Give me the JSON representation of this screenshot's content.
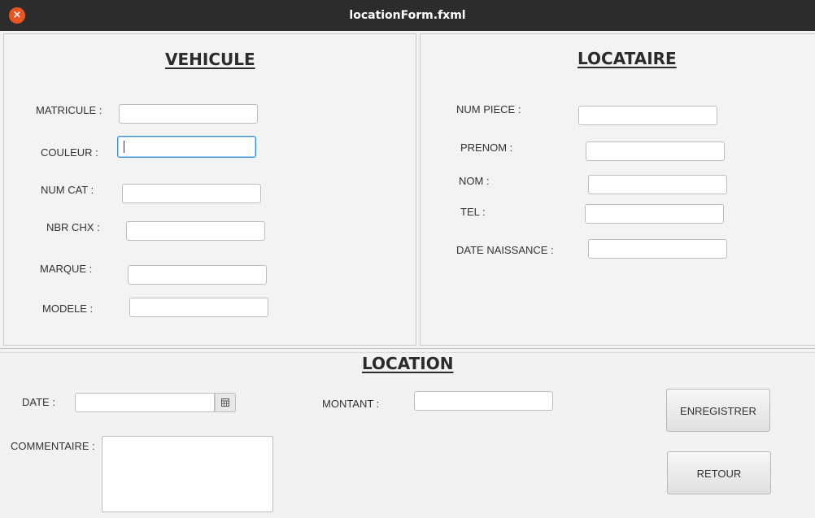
{
  "window": {
    "title": "locationForm.fxml",
    "close_symbol": "×"
  },
  "vehicule": {
    "heading": "VEHICULE",
    "matricule_label": "MATRICULE :",
    "couleur_label": "COULEUR :",
    "numcat_label": "NUM CAT :",
    "nbrchx_label": "NBR CHX :",
    "marque_label": "MARQUE :",
    "modele_label": "MODELE :",
    "matricule_value": "",
    "couleur_value": "",
    "numcat_value": "",
    "nbrchx_value": "",
    "marque_value": "",
    "modele_value": ""
  },
  "locataire": {
    "heading": "LOCATAIRE",
    "numpiece_label": "NUM PIECE :",
    "prenom_label": "PRENOM :",
    "nom_label": "NOM :",
    "tel_label": "TEL :",
    "datenaissance_label": "DATE NAISSANCE :",
    "numpiece_value": "",
    "prenom_value": "",
    "nom_value": "",
    "tel_value": "",
    "datenaissance_value": ""
  },
  "location": {
    "heading": "LOCATION",
    "date_label": "DATE :",
    "montant_label": "MONTANT :",
    "commentaire_label": "COMMENTAIRE :",
    "date_value": "",
    "montant_value": "",
    "commentaire_value": "",
    "calendar_icon": "calendar-icon",
    "save_label": "ENREGISTRER",
    "back_label": "RETOUR"
  }
}
